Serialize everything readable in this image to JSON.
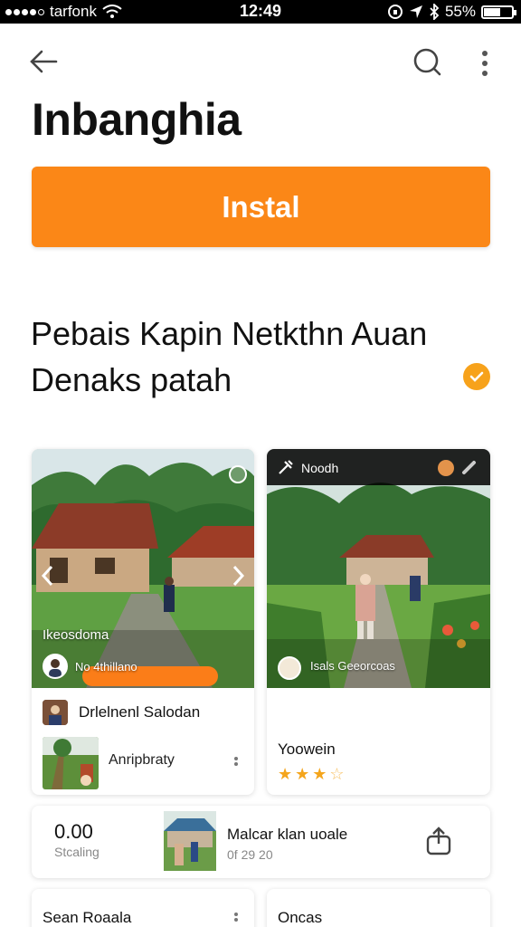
{
  "status_bar": {
    "carrier": "tarfonk",
    "time": "12:49",
    "battery_percent": "55%",
    "battery_level": 0.55
  },
  "header": {
    "back_icon": "arrow-left-icon",
    "search_icon": "search-icon",
    "more_icon": "more-vertical-icon"
  },
  "app": {
    "title": "Inbanghia",
    "install_label": "Instal",
    "description_line1": "Pebais Kapin Netkthn Auan",
    "description_line2": "Denaks patah",
    "accent_color": "#fb8717"
  },
  "cards": {
    "card1": {
      "photo_caption": "Ikeosdoma",
      "photo_subtext": "No 4thillano",
      "row_title": "Drlelnenl Salodan",
      "row_subtitle": "Anripbraty"
    },
    "card2": {
      "top_label": "Noodh",
      "photo_caption": "Isals Geeorcoas",
      "title": "Yoowein",
      "rating": 3.5,
      "stars": [
        "★",
        "★",
        "★",
        "☆"
      ]
    },
    "card3": {
      "value": "0.00",
      "value_label": "Stcaling",
      "name": "Malcar klan uoale",
      "date": "0f 29 20"
    },
    "card4": {
      "label": "Sean Roaala"
    },
    "card5": {
      "label": "Oncas"
    }
  }
}
